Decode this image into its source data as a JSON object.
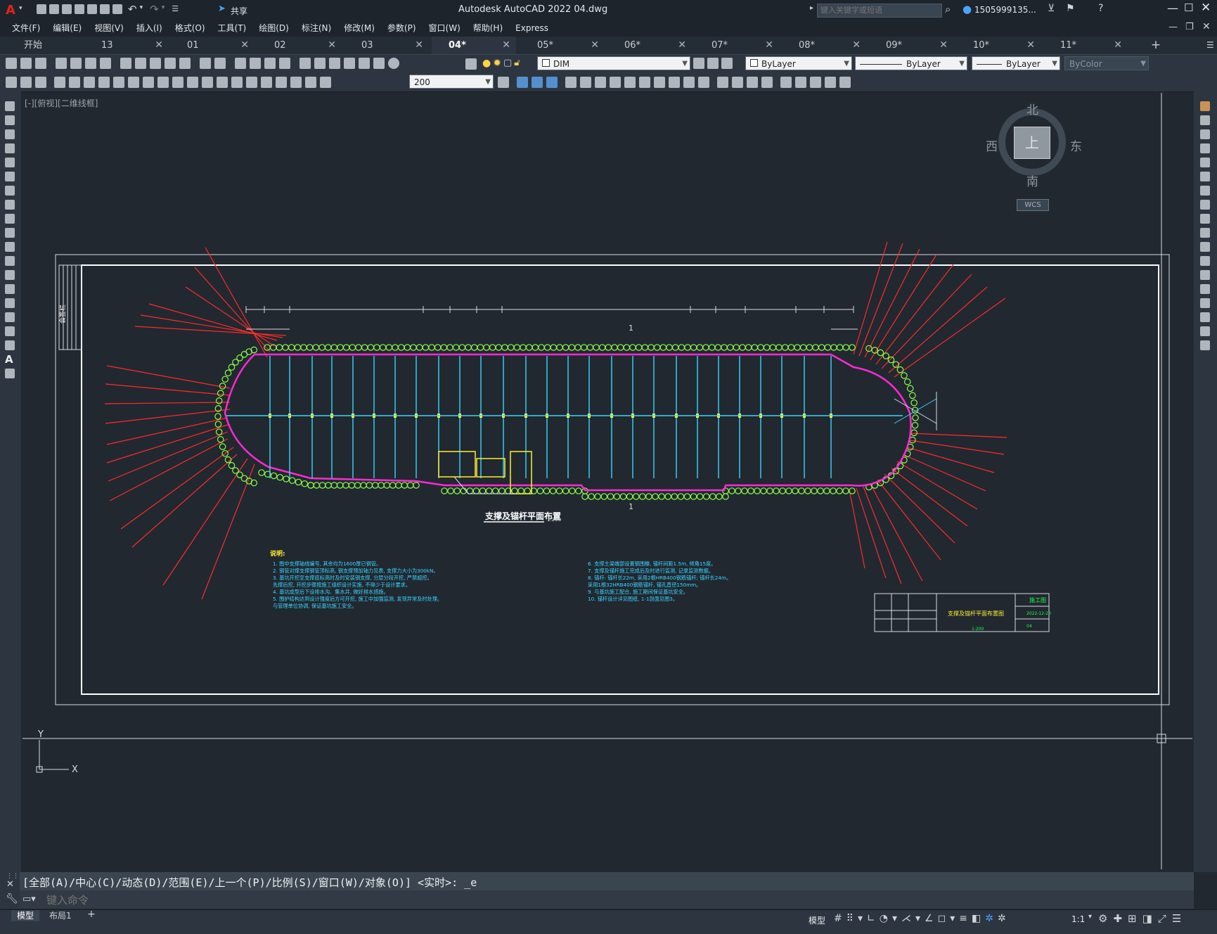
{
  "app": {
    "title": "Autodesk AutoCAD 2022    04.dwg",
    "share_label": "共享",
    "search_placeholder": "键入关键字或短语",
    "user": "1505999135...",
    "accent": "#e2231a"
  },
  "menu": [
    "文件(F)",
    "编辑(E)",
    "视图(V)",
    "插入(I)",
    "格式(O)",
    "工具(T)",
    "绘图(D)",
    "标注(N)",
    "修改(M)",
    "参数(P)",
    "窗口(W)",
    "帮助(H)",
    "Express"
  ],
  "tabs": [
    {
      "label": "开始",
      "active": false,
      "closable": false
    },
    {
      "label": "13",
      "active": false,
      "closable": true
    },
    {
      "label": "01",
      "active": false,
      "closable": true
    },
    {
      "label": "02",
      "active": false,
      "closable": true
    },
    {
      "label": "03",
      "active": false,
      "closable": true
    },
    {
      "label": "04*",
      "active": true,
      "closable": true
    },
    {
      "label": "05*",
      "active": false,
      "closable": true
    },
    {
      "label": "06*",
      "active": false,
      "closable": true
    },
    {
      "label": "07*",
      "active": false,
      "closable": true
    },
    {
      "label": "08*",
      "active": false,
      "closable": true
    },
    {
      "label": "09*",
      "active": false,
      "closable": true
    },
    {
      "label": "10*",
      "active": false,
      "closable": true
    },
    {
      "label": "11*",
      "active": false,
      "closable": true
    }
  ],
  "properties": {
    "layer": "DIM",
    "color": "ByLayer",
    "linetype": "ByLayer",
    "lineweight": "ByLayer",
    "plotstyle": "ByColor",
    "dimscale": "200"
  },
  "viewport_label": "[-][俯视][二维线框]",
  "viewcube": {
    "north": "北",
    "south": "南",
    "east": "东",
    "west": "西",
    "top": "上",
    "wcs": "WCS"
  },
  "ucs": {
    "x": "X",
    "y": "Y"
  },
  "drawing": {
    "title": "支撑及锚杆平面布置",
    "scale": "1:200",
    "notes_heading": "说明:",
    "notes_left": [
      "1. 图中支撑轴线编号, 其余均为1600厚已钢管。",
      "2. 钢管对撑支撑钢管顶标高, 钢支撑预加轴力见表, 支撑力大小为300kN。",
      "3. 基坑开挖至支撑底标高时及时安装钢支撑, 分层分段开挖, 严禁超挖。",
      "   先撑后挖, 开挖步骤按施工组织设计实施, 不得少于设计要求。",
      "4. 基坑成型后下设排水沟、集水井, 做好排水措施。",
      "5. 围护结构达到设计强度后方可开挖, 施工中加强监测, 发现异常及时处理。",
      "   与管理单位协调, 保证基坑施工安全。"
    ],
    "notes_right": [
      "6. 支撑主梁端部设置钢围檩, 锚杆间距1.5m, 倾角15度。",
      "7. 支撑及锚杆施工完成后及时进行监测, 记录监测数据。",
      "8. 锚杆: 锚杆长22m, 采用2根HRB400钢筋锚杆; 锚杆长24m。",
      "   采用1根32HRB400钢筋锚杆, 锚孔直径150mm。",
      "9. 与基坑施工配合, 施工期间保证基坑安全。",
      "10. 锚杆设计详见图纸, 1-1剖面见图3。"
    ],
    "titleblock": {
      "project": "施工图",
      "name": "支撑及锚杆平面布置图",
      "date": "2022-12-20",
      "sheet": "04",
      "scale": "1:200"
    },
    "side_label": "会签栏"
  },
  "command": {
    "history": "[全部(A)/中心(C)/动态(D)/范围(E)/上一个(P)/比例(S)/窗口(W)/对象(O)] <实时>: _e",
    "placeholder": "键入命令"
  },
  "layout_tabs": [
    "模型",
    "布局1"
  ],
  "status": {
    "model": "模型",
    "scale": "1:1"
  }
}
